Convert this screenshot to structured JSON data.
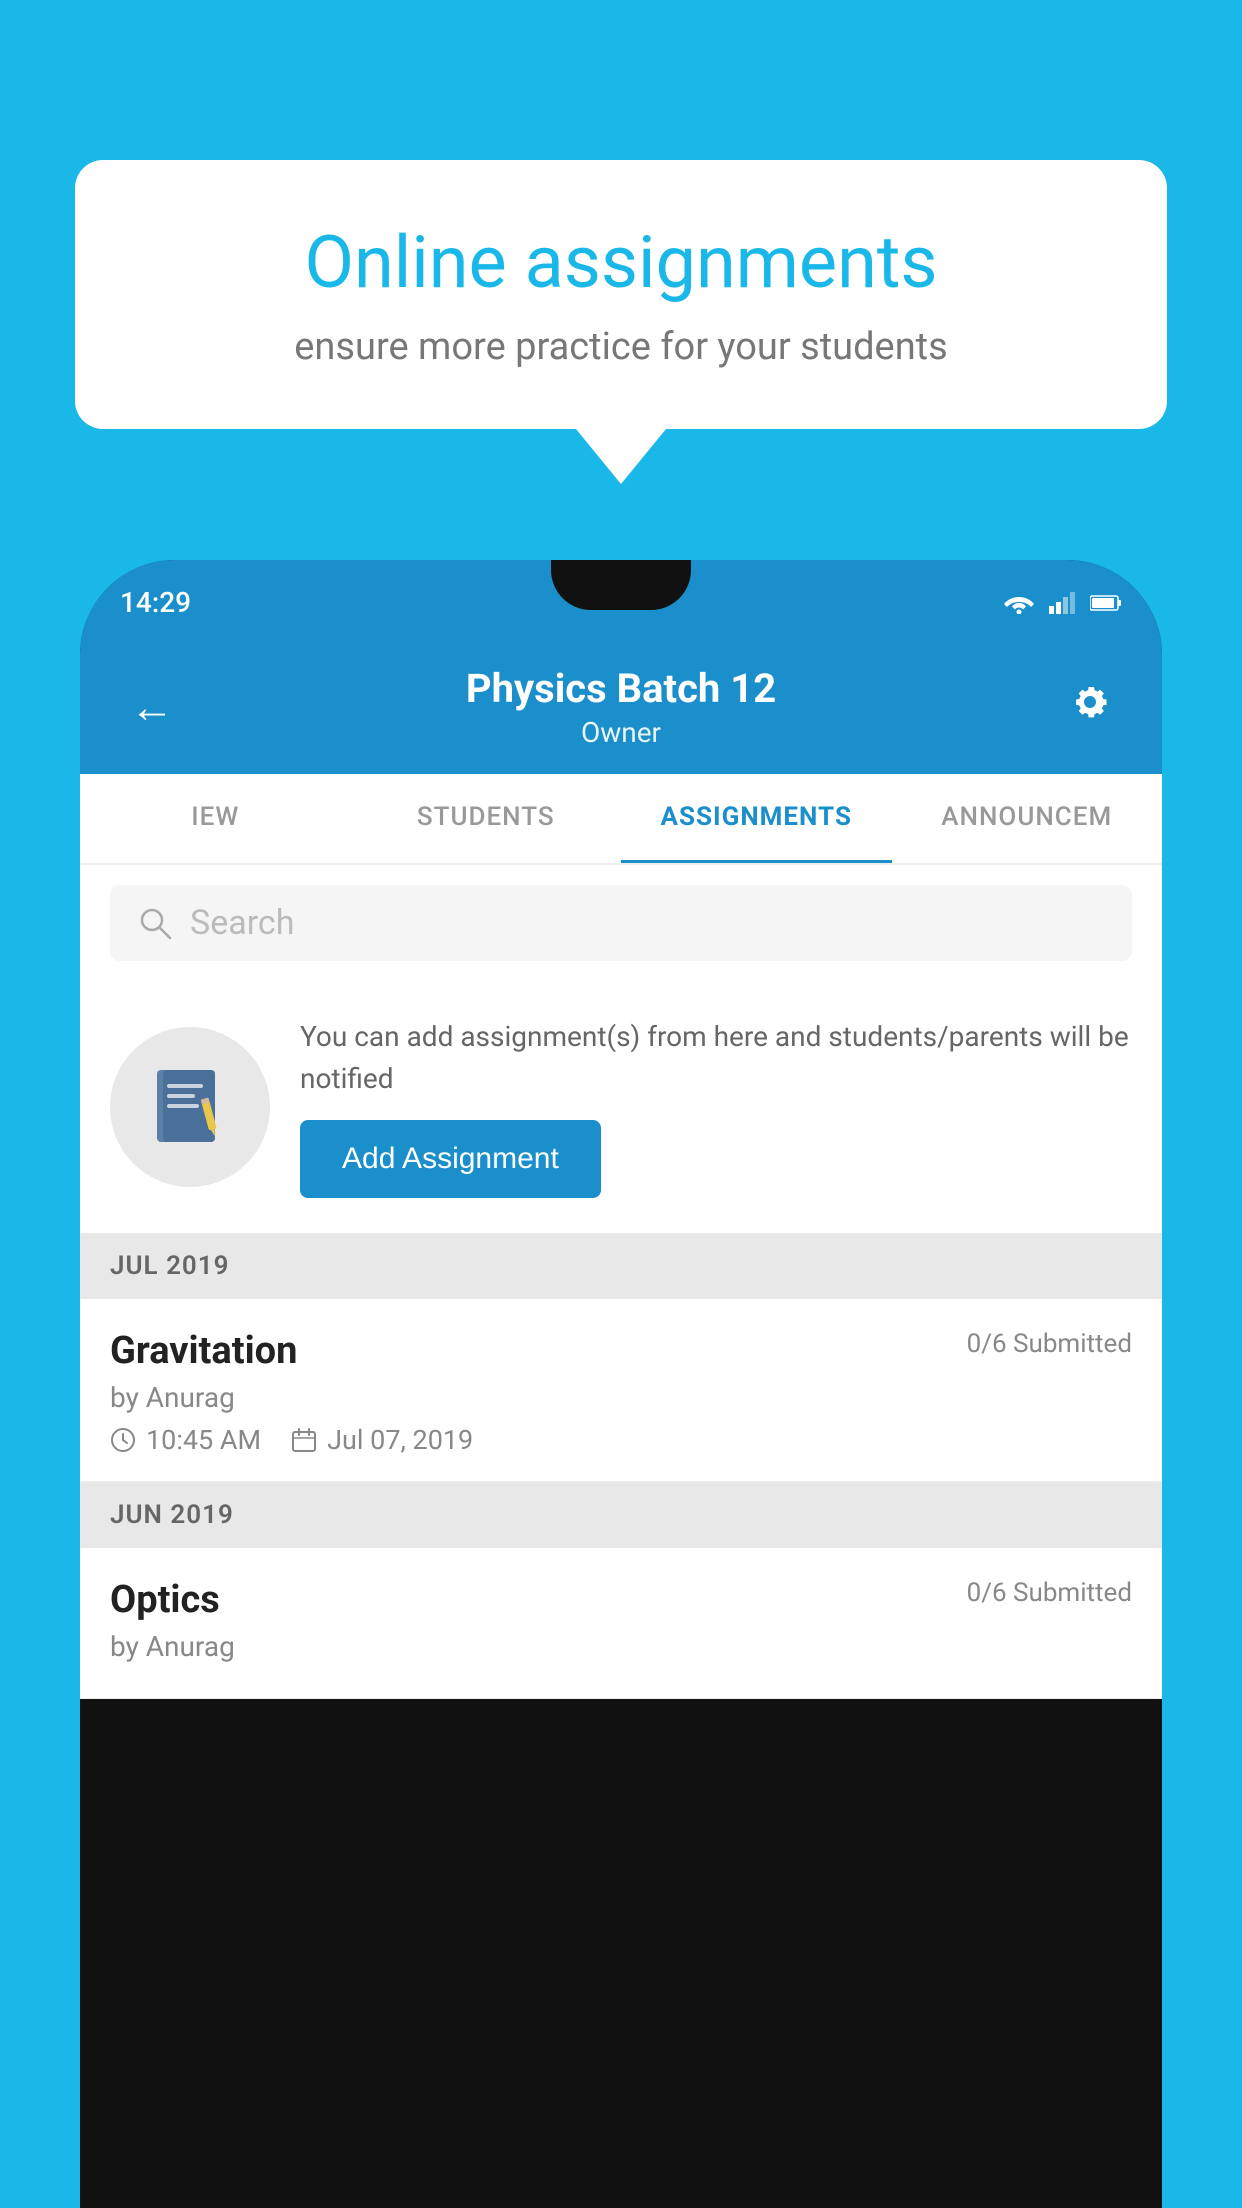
{
  "background_color": "#1ab8e8",
  "speech_bubble": {
    "title": "Online assignments",
    "subtitle": "ensure more practice for your students"
  },
  "phone": {
    "status_bar": {
      "time": "14:29"
    },
    "header": {
      "title": "Physics Batch 12",
      "subtitle": "Owner",
      "back_label": "←",
      "settings_label": "⚙"
    },
    "tabs": [
      {
        "label": "IEW",
        "active": false
      },
      {
        "label": "STUDENTS",
        "active": false
      },
      {
        "label": "ASSIGNMENTS",
        "active": true
      },
      {
        "label": "ANNOUNCEM",
        "active": false
      }
    ],
    "search": {
      "placeholder": "Search"
    },
    "promo": {
      "description": "You can add assignment(s) from here and students/parents will be notified",
      "button_label": "Add Assignment"
    },
    "sections": [
      {
        "header": "JUL 2019",
        "assignments": [
          {
            "name": "Gravitation",
            "submitted": "0/6 Submitted",
            "by": "by Anurag",
            "time": "10:45 AM",
            "date": "Jul 07, 2019"
          }
        ]
      },
      {
        "header": "JUN 2019",
        "assignments": [
          {
            "name": "Optics",
            "submitted": "0/6 Submitted",
            "by": "by Anurag",
            "time": "",
            "date": ""
          }
        ]
      }
    ]
  }
}
